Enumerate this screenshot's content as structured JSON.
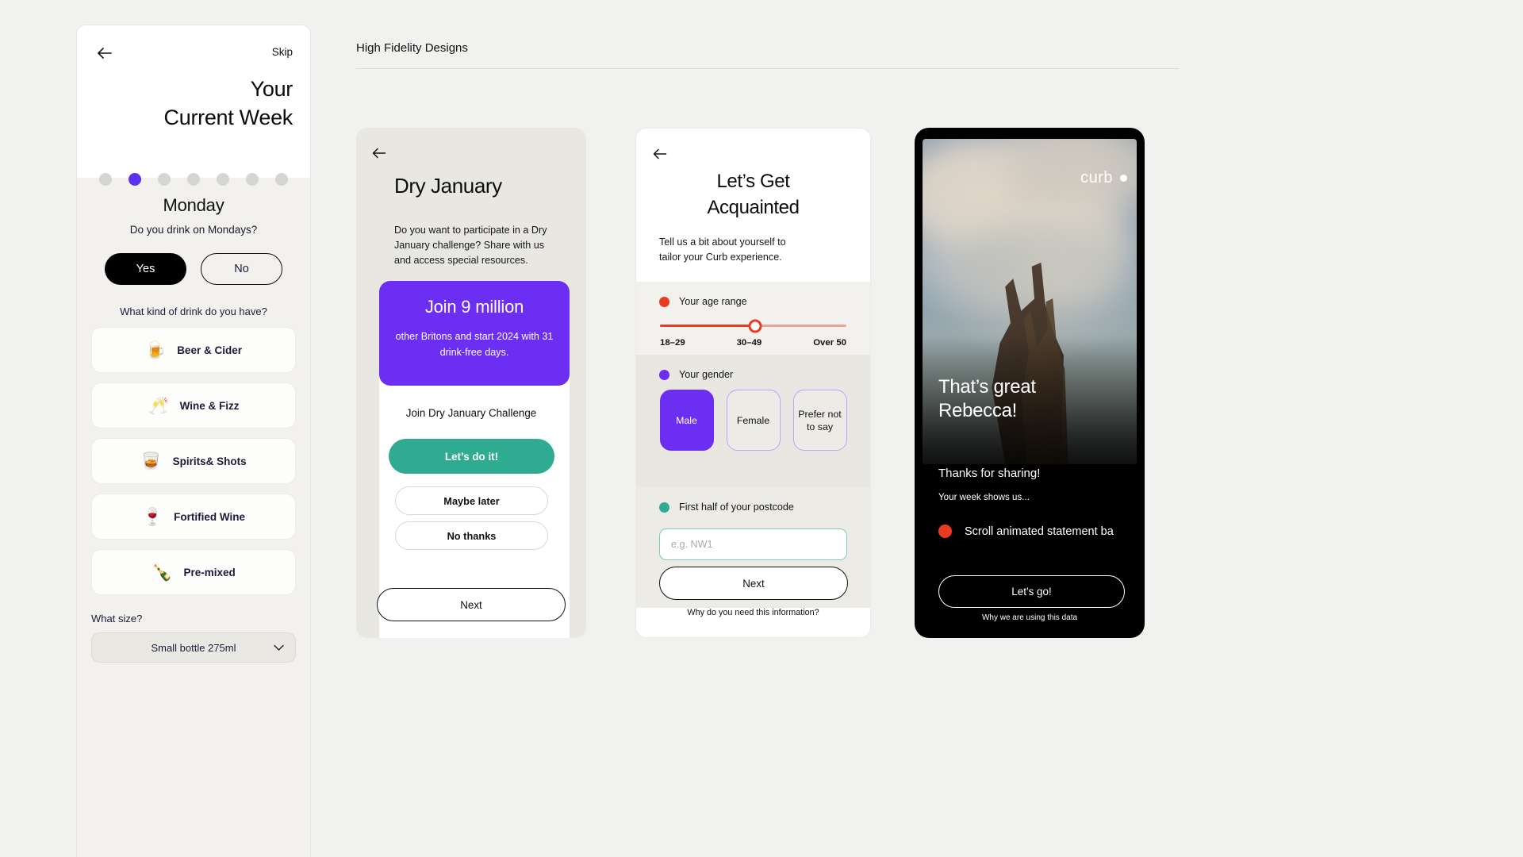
{
  "header": {
    "title": "High Fidelity Designs"
  },
  "left_panel": {
    "back_icon": "back-arrow-icon",
    "skip_label": "Skip",
    "title_line1": "Your",
    "title_line2": "Current Week",
    "dots_total": 7,
    "dots_active_index": 1,
    "day_title": "Monday",
    "day_question": "Do you drink on Mondays?",
    "yes_label": "Yes",
    "no_label": "No",
    "drink_question": "What kind of drink do you have?",
    "drinks": [
      {
        "emoji": "🍺",
        "label": "Beer & Cider",
        "icon": "beer-glass-icon"
      },
      {
        "emoji": "🥂",
        "label": "Wine & Fizz",
        "icon": "champagne-flute-icon"
      },
      {
        "emoji": "🥃",
        "label": "Spirits& Shots",
        "icon": "whisky-tumbler-icon"
      },
      {
        "emoji": "🍷",
        "label": "Fortified Wine",
        "icon": "red-wine-glass-icon"
      },
      {
        "emoji": "🍾",
        "label": "Pre-mixed",
        "icon": "bottle-icon"
      }
    ],
    "size_label": "What size?",
    "size_value": "Small bottle 275ml"
  },
  "panel_dry_january": {
    "back_icon": "back-arrow-icon",
    "title": "Dry January",
    "description": "Do you want to participate in a Dry January challenge? Share with us and access special resources.",
    "card_big": "Join 9 million",
    "card_small": "other Britons and start 2024 with 31 drink-free days.",
    "join_text": "Join Dry January Challenge",
    "cta_primary": "Let’s do it!",
    "cta_maybe": "Maybe later",
    "cta_no": "No thanks",
    "next_label": "Next"
  },
  "panel_acquainted": {
    "back_icon": "back-arrow-icon",
    "title_line1": "Let’s Get",
    "title_line2": "Acquainted",
    "subtitle": "Tell us a bit about yourself to tailor your Curb experience.",
    "age_label": "Your age range",
    "age_ticks": [
      "18–29",
      "30–49",
      "Over 50"
    ],
    "age_selected": "30–49",
    "gender_label": "Your gender",
    "gender_options": [
      {
        "label": "Male",
        "selected": true
      },
      {
        "label": "Female",
        "selected": false
      },
      {
        "label": "Prefer not to say",
        "selected": false
      }
    ],
    "postcode_label": "First half of your postcode",
    "postcode_placeholder": "e.g. NW1",
    "postcode_value": "",
    "next_label": "Next",
    "why_label": "Why do you need this information?",
    "colors": {
      "red": "#ea3b21",
      "violet": "#6c2ef2",
      "teal": "#2fab92"
    }
  },
  "panel_phone": {
    "logo": "curb",
    "headline_line1": "That’s great",
    "headline_line2": "Rebecca!",
    "thanks": "Thanks for sharing!",
    "week_text": "Your week shows us...",
    "scroll_text": "Scroll animated statement ba",
    "cta_label": "Let’s go!",
    "why_label": "Why we are using this data"
  }
}
